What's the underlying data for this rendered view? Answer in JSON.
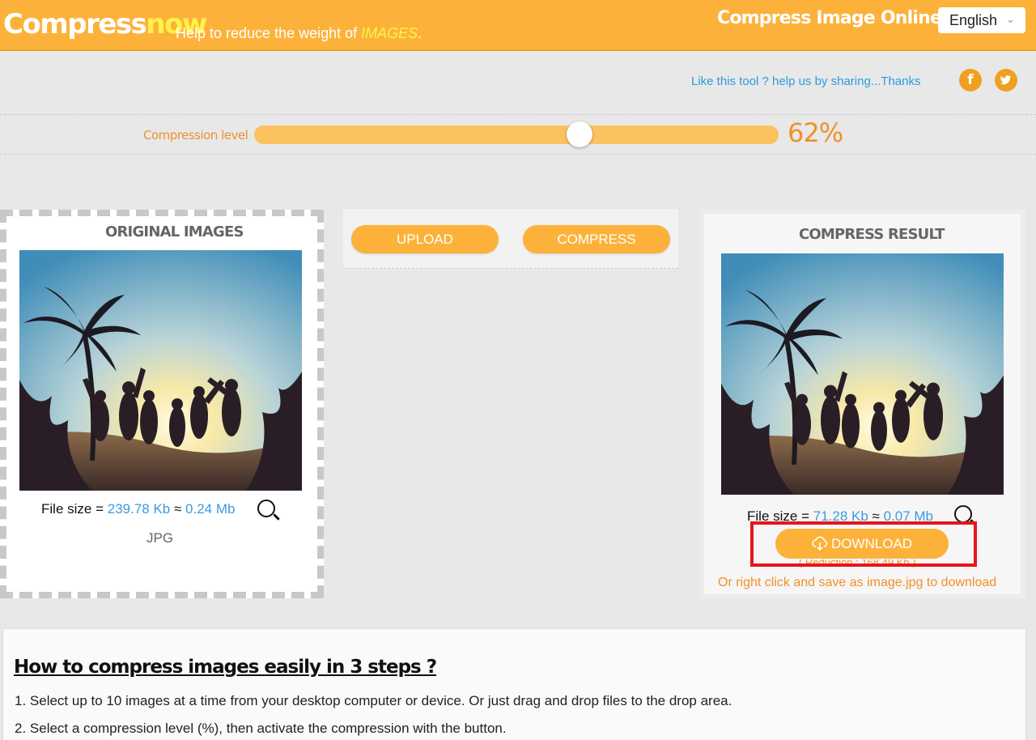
{
  "header": {
    "logo_main": "Compress",
    "logo_accent": "now",
    "tagline_text": "Help to reduce the weight of ",
    "tagline_emphasis": "IMAGES",
    "tagline_end": ".",
    "title": "Compress Image Online",
    "language": "English"
  },
  "share": {
    "text": "Like this tool ? help us by sharing...Thanks",
    "facebook_glyph": "f",
    "twitter_glyph": "🐦"
  },
  "compression": {
    "label": "Compression level",
    "value_text": "62%",
    "level": 0.62
  },
  "original": {
    "title": "ORIGINAL IMAGES",
    "file_size_label": "File size = ",
    "size_kb": "239.78 Kb",
    "approx": " ≈ ",
    "size_mb": "0.24 Mb",
    "format": "JPG"
  },
  "actions": {
    "upload": "UPLOAD",
    "compress": "COMPRESS"
  },
  "result": {
    "title": "COMPRESS RESULT",
    "file_size_label": "File size = ",
    "size_kb": "71.28 Kb",
    "approx": " ≈ ",
    "size_mb": "0.07 Mb",
    "download": "DOWNLOAD",
    "reduction": "( Reduction : 168.49 Kb )",
    "save_hint": "Or right click and save as image.jpg to download"
  },
  "howto": {
    "title": "How to compress images easily in 3 steps ?",
    "steps": [
      "1. Select up to 10 images at a time from your desktop computer or device. Or just drag and drop files to the drop area.",
      "2. Select a compression level (%), then activate the compression with the button."
    ]
  },
  "colors": {
    "brand": "#fcb23a",
    "accent_text": "#f0902a",
    "link": "#3a9be0",
    "highlight": "#e8141b"
  },
  "icons": [
    "chevron-down-icon",
    "facebook-icon",
    "twitter-icon",
    "magnifier-icon",
    "cloud-download-icon"
  ]
}
